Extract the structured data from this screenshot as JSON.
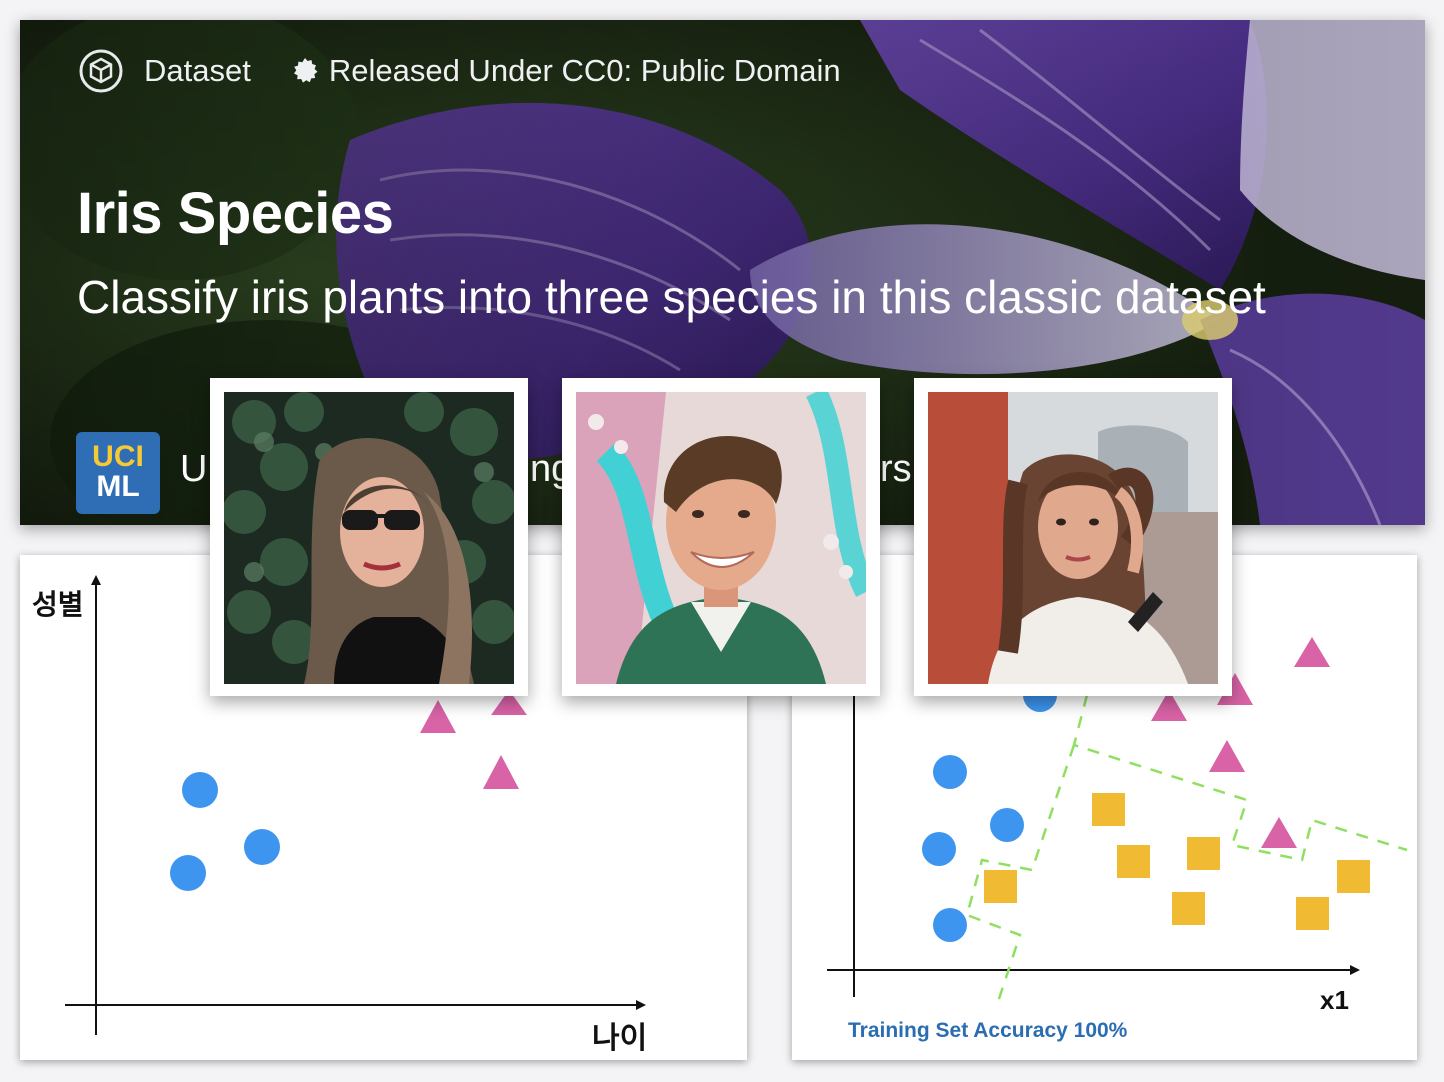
{
  "banner": {
    "type_label": "Dataset",
    "license_label": "Released Under CC0: Public Domain",
    "title": "Iris Species",
    "subtitle": "Classify iris plants into three species in this classic dataset",
    "owner_logo": {
      "line1": "UCI",
      "line2": "ML"
    },
    "owner_visible": [
      "U",
      "ng",
      "rs"
    ],
    "icons": [
      "dataset-icon",
      "license-badge-icon"
    ]
  },
  "left_chart": {
    "ylabel": "성별",
    "xlabel": "나이",
    "point_colors": {
      "circle": "#3d95ef",
      "triangle": "#d863a6"
    }
  },
  "right_chart": {
    "xlabel": "x1",
    "accuracy_text": "Training Set Accuracy 100%",
    "point_colors": {
      "circle": "#3d95ef",
      "triangle": "#d863a6",
      "square": "#f0bb33",
      "boundary": "#8fe060"
    }
  },
  "photos": [
    {
      "name": "woman-with-sunglasses-photo"
    },
    {
      "name": "smiling-man-photo"
    },
    {
      "name": "woman-with-long-hair-photo"
    }
  ]
}
